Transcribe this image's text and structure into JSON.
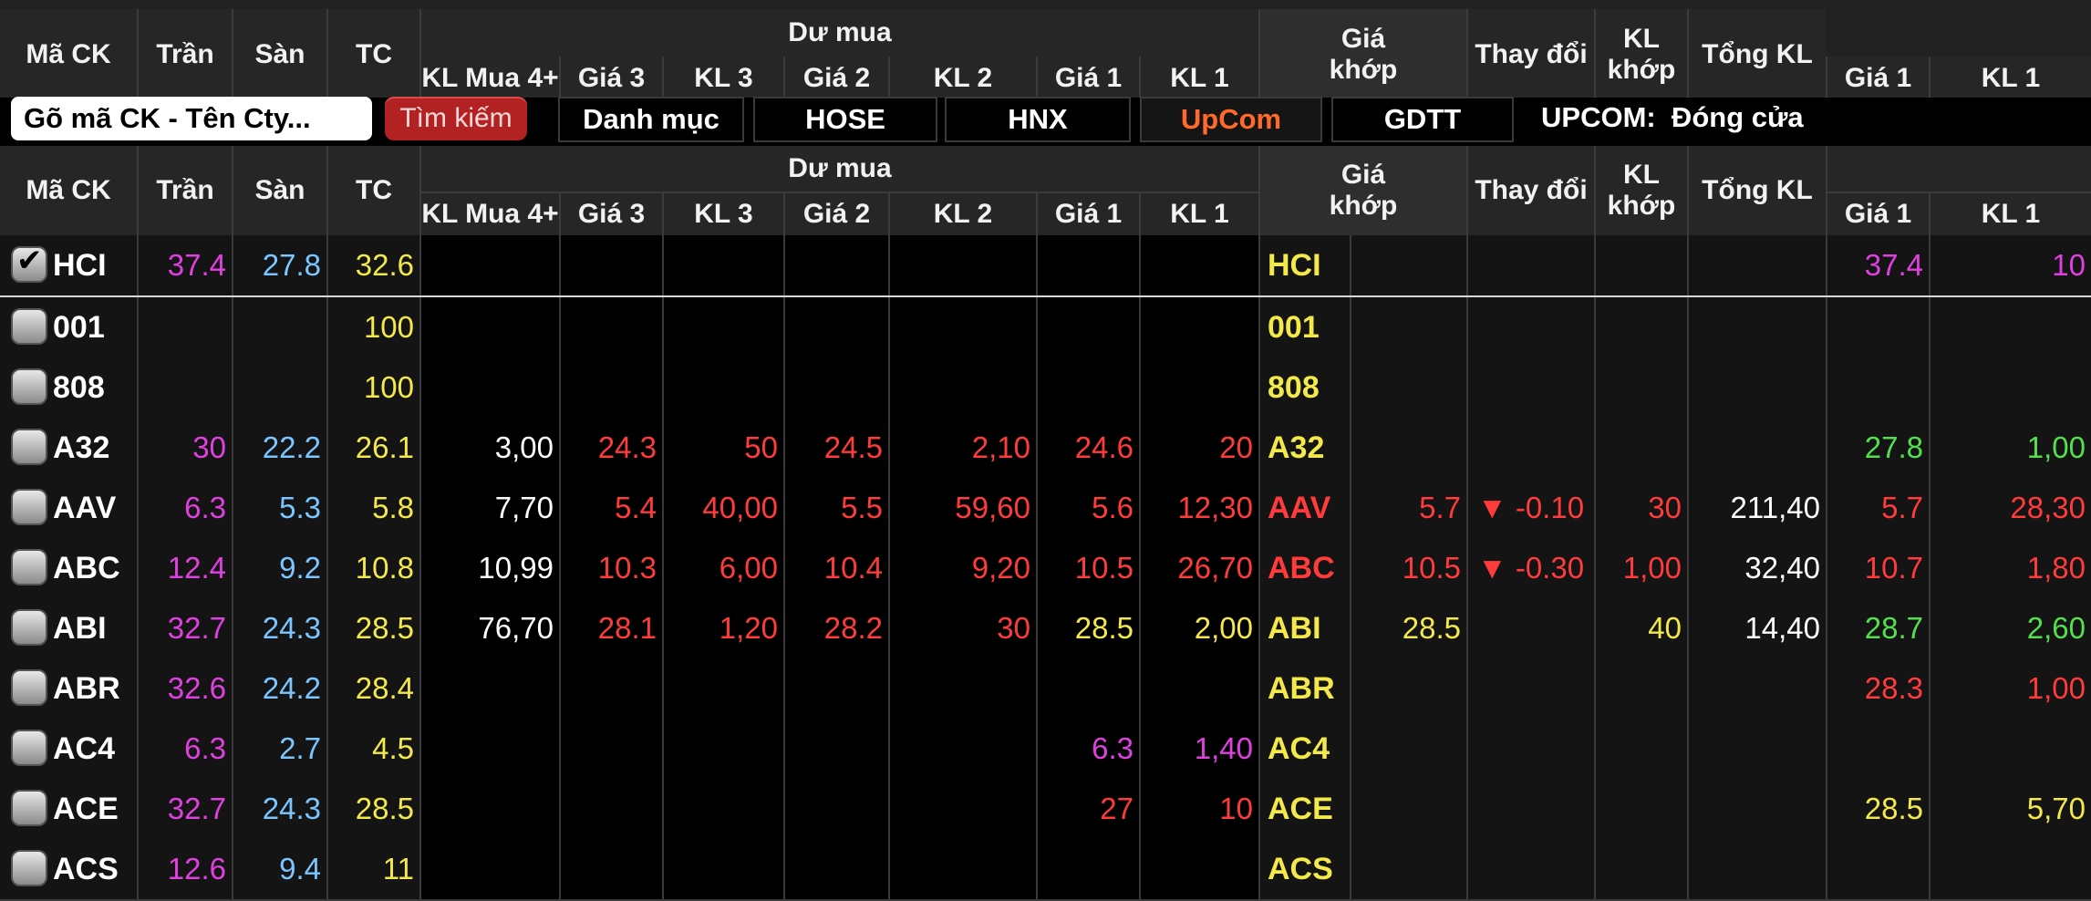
{
  "colors": {
    "ceiling": "#e040e0",
    "floor": "#7cc6ff",
    "ref": "#f3e94b",
    "down": "#ff3b3b",
    "up": "#54e04e",
    "neutral": "#ffffff"
  },
  "headers": {
    "ma_ck": "Mã CK",
    "tran": "Trần",
    "san": "Sàn",
    "tc": "TC",
    "du_mua": "Dư mua",
    "kl_mua4": "KL Mua 4+",
    "gia3": "Giá 3",
    "kl3": "KL 3",
    "gia2": "Giá 2",
    "kl2": "KL 2",
    "gia1": "Giá 1",
    "kl1": "KL 1",
    "gia_khop": "Giá khớp",
    "thay_doi": "Thay đổi",
    "kl_khop": "KL khớp",
    "tong_kl": "Tổng KL",
    "ban_gia1": "Giá 1",
    "ban_kl1": "KL 1"
  },
  "toolbar": {
    "search_placeholder": "Gõ mã CK - Tên Cty...",
    "search_button": "Tìm kiếm",
    "tabs": [
      "Danh mục",
      "HOSE",
      "HNX",
      "UpCom",
      "GDTT"
    ],
    "selected_tab": "UpCom",
    "status_label": "UPCOM:  Đóng cửa"
  },
  "rows": [
    {
      "sym": "HCI",
      "checked": true,
      "tran": "37.4",
      "san": "27.8",
      "tc": "32.6",
      "klm4": "",
      "g3": "",
      "kl3": "",
      "g2": "",
      "kl2": "",
      "g1": "",
      "kl1": "",
      "sym2": "HCI",
      "sym2_color": "ref",
      "gk": "",
      "td": "",
      "klk": "",
      "tkl": "",
      "bg1": "37.4",
      "bg1_color": "ceiling",
      "bkl1": "10",
      "bkl1_color": "ceiling"
    },
    {
      "sym": "001",
      "checked": false,
      "tran": "",
      "san": "",
      "tc": "100",
      "klm4": "",
      "g3": "",
      "kl3": "",
      "g2": "",
      "kl2": "",
      "g1": "",
      "kl1": "",
      "sym2": "001",
      "sym2_color": "ref",
      "gk": "",
      "td": "",
      "klk": "",
      "tkl": "",
      "bg1": "",
      "bkl1": ""
    },
    {
      "sym": "808",
      "checked": false,
      "tran": "",
      "san": "",
      "tc": "100",
      "klm4": "",
      "g3": "",
      "kl3": "",
      "g2": "",
      "kl2": "",
      "g1": "",
      "kl1": "",
      "sym2": "808",
      "sym2_color": "ref",
      "gk": "",
      "td": "",
      "klk": "",
      "tkl": "",
      "bg1": "",
      "bkl1": ""
    },
    {
      "sym": "A32",
      "checked": false,
      "tran": "30",
      "san": "22.2",
      "tc": "26.1",
      "klm4": "3,00",
      "g3": "24.3",
      "kl3": "50",
      "g2": "24.5",
      "kl2": "2,10",
      "g1": "24.6",
      "kl1": "20",
      "bid_color": "down",
      "g1_color": "down",
      "sym2": "A32",
      "sym2_color": "ref",
      "gk": "",
      "td": "",
      "klk": "",
      "tkl": "",
      "bg1": "27.8",
      "bg1_color": "up",
      "bkl1": "1,00",
      "bkl1_color": "up"
    },
    {
      "sym": "AAV",
      "checked": false,
      "tran": "6.3",
      "san": "5.3",
      "tc": "5.8",
      "klm4": "7,70",
      "g3": "5.4",
      "kl3": "40,00",
      "g2": "5.5",
      "kl2": "59,60",
      "g1": "5.6",
      "kl1": "12,30",
      "bid_color": "down",
      "g1_color": "down",
      "sym2": "AAV",
      "sym2_color": "down",
      "gk": "5.7",
      "gk_color": "down",
      "td": "▼ -0.10",
      "klk": "30",
      "klk_color": "down",
      "tkl": "211,40",
      "bg1": "5.7",
      "bg1_color": "down",
      "bkl1": "28,30",
      "bkl1_color": "down"
    },
    {
      "sym": "ABC",
      "checked": false,
      "tran": "12.4",
      "san": "9.2",
      "tc": "10.8",
      "klm4": "10,99",
      "g3": "10.3",
      "kl3": "6,00",
      "g2": "10.4",
      "kl2": "9,20",
      "g1": "10.5",
      "kl1": "26,70",
      "bid_color": "down",
      "g1_color": "down",
      "sym2": "ABC",
      "sym2_color": "down",
      "gk": "10.5",
      "gk_color": "down",
      "td": "▼ -0.30",
      "klk": "1,00",
      "klk_color": "down",
      "tkl": "32,40",
      "bg1": "10.7",
      "bg1_color": "down",
      "bkl1": "1,80",
      "bkl1_color": "down"
    },
    {
      "sym": "ABI",
      "checked": false,
      "tran": "32.7",
      "san": "24.3",
      "tc": "28.5",
      "klm4": "76,70",
      "g3": "28.1",
      "kl3": "1,20",
      "g2": "28.2",
      "kl2": "30",
      "g1": "28.5",
      "kl1": "2,00",
      "bid_color": "down",
      "g1_color": "ref",
      "sym2": "ABI",
      "sym2_color": "ref",
      "gk": "28.5",
      "gk_color": "ref",
      "td": "",
      "klk": "40",
      "klk_color": "ref",
      "tkl": "14,40",
      "bg1": "28.7",
      "bg1_color": "up",
      "bkl1": "2,60",
      "bkl1_color": "up"
    },
    {
      "sym": "ABR",
      "checked": false,
      "tran": "32.6",
      "san": "24.2",
      "tc": "28.4",
      "klm4": "",
      "g3": "",
      "kl3": "",
      "g2": "",
      "kl2": "",
      "g1": "",
      "kl1": "",
      "sym2": "ABR",
      "sym2_color": "ref",
      "gk": "",
      "td": "",
      "klk": "",
      "tkl": "",
      "bg1": "28.3",
      "bg1_color": "down",
      "bkl1": "1,00",
      "bkl1_color": "down"
    },
    {
      "sym": "AC4",
      "checked": false,
      "tran": "6.3",
      "san": "2.7",
      "tc": "4.5",
      "klm4": "",
      "g3": "",
      "kl3": "",
      "g2": "",
      "kl2": "",
      "g1": "6.3",
      "kl1": "1,40",
      "g1_color": "ceiling",
      "sym2": "AC4",
      "sym2_color": "ref",
      "gk": "",
      "td": "",
      "klk": "",
      "tkl": "",
      "bg1": "",
      "bkl1": ""
    },
    {
      "sym": "ACE",
      "checked": false,
      "tran": "32.7",
      "san": "24.3",
      "tc": "28.5",
      "klm4": "",
      "g3": "",
      "kl3": "",
      "g2": "",
      "kl2": "",
      "g1": "27",
      "kl1": "10",
      "g1_color": "down",
      "sym2": "ACE",
      "sym2_color": "ref",
      "gk": "",
      "td": "",
      "klk": "",
      "tkl": "",
      "bg1": "28.5",
      "bg1_color": "ref",
      "bkl1": "5,70",
      "bkl1_color": "ref"
    },
    {
      "sym": "ACS",
      "checked": false,
      "tran": "12.6",
      "san": "9.4",
      "tc": "11",
      "klm4": "",
      "g3": "",
      "kl3": "",
      "g2": "",
      "kl2": "",
      "g1": "",
      "kl1": "",
      "sym2": "ACS",
      "sym2_color": "ref",
      "gk": "",
      "td": "",
      "klk": "",
      "tkl": "",
      "bg1": "",
      "bkl1": ""
    }
  ]
}
